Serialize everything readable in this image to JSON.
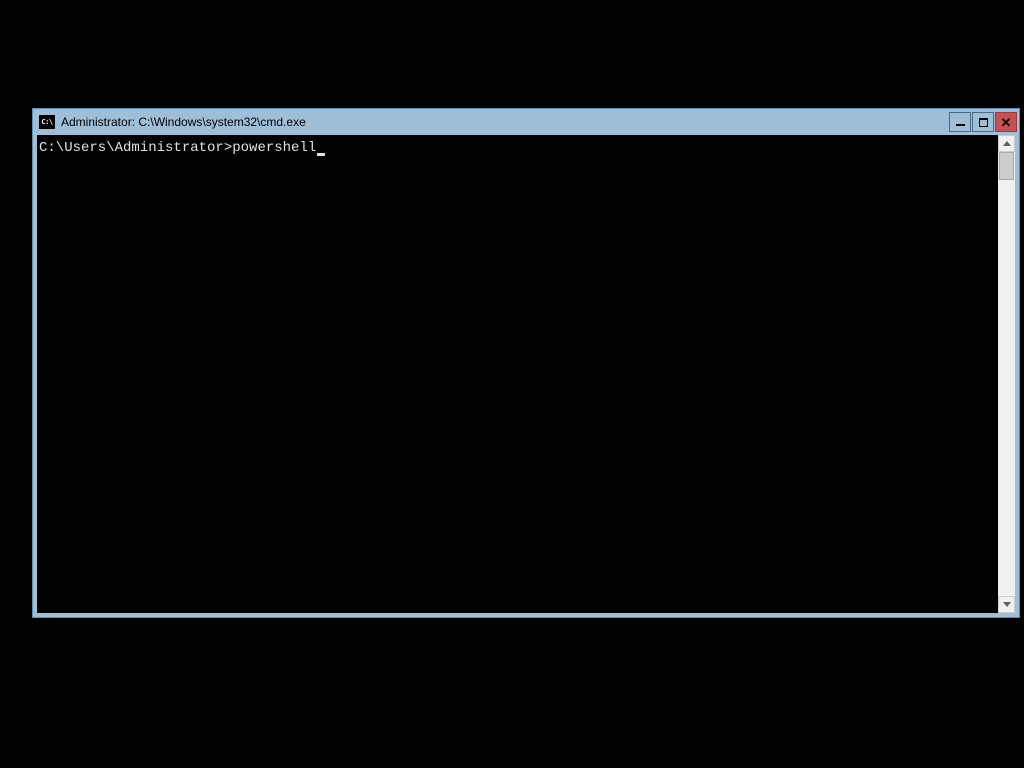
{
  "window": {
    "title": "Administrator: C:\\Windows\\system32\\cmd.exe",
    "icon_label": "C:\\"
  },
  "terminal": {
    "prompt": "C:\\Users\\Administrator>",
    "command": "powershell"
  }
}
